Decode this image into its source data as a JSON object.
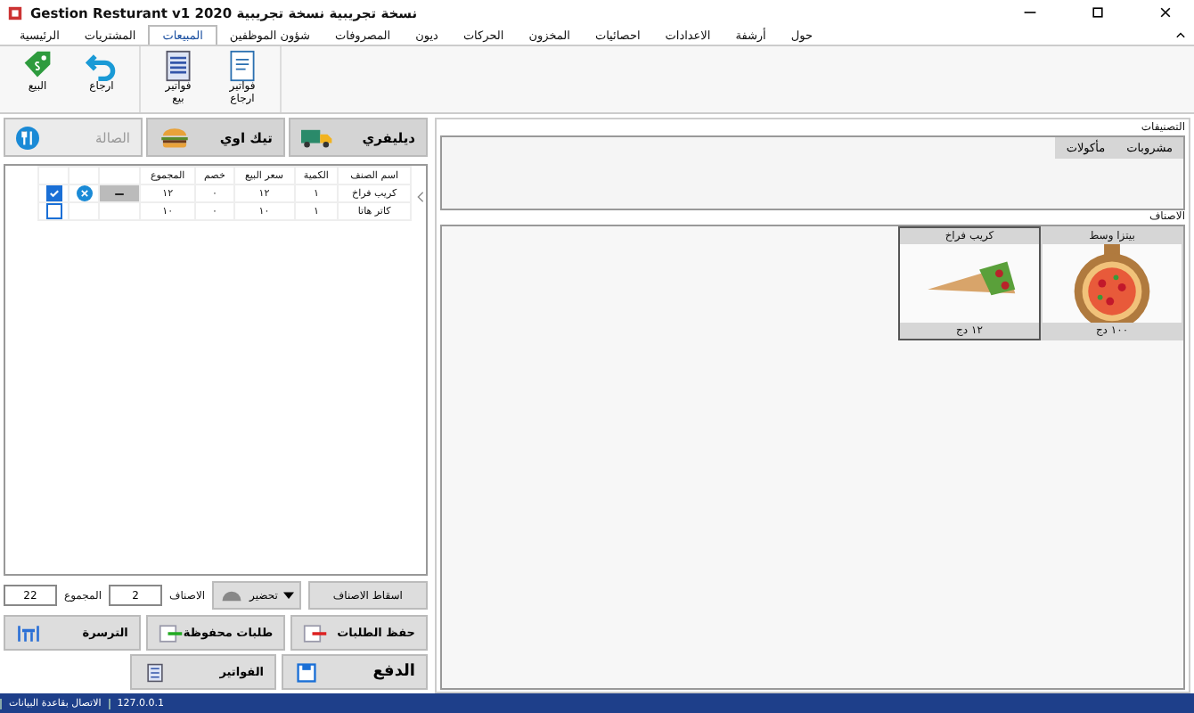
{
  "window": {
    "title": "Gestion Resturant v1 2020 نسخة تجريبية نسخة تجريبية"
  },
  "menu": [
    {
      "label": "حول",
      "selected": false
    },
    {
      "label": "أرشفة",
      "selected": false
    },
    {
      "label": "الاعدادات",
      "selected": false
    },
    {
      "label": "احصائيات",
      "selected": false
    },
    {
      "label": "المخزون",
      "selected": false
    },
    {
      "label": "الحركات",
      "selected": false
    },
    {
      "label": "ديون",
      "selected": false
    },
    {
      "label": "المصروفات",
      "selected": false
    },
    {
      "label": "شؤون الموظفين",
      "selected": false
    },
    {
      "label": "المبيعات",
      "selected": true
    },
    {
      "label": "المشتريات",
      "selected": false
    },
    {
      "label": "الرئيسية",
      "selected": false
    }
  ],
  "ribbon": [
    {
      "label": "فواتير\nارجاع",
      "kind": "doc"
    },
    {
      "label": "فواتير\nبيع",
      "kind": "list"
    },
    {
      "label": "ارجاع",
      "kind": "undo"
    },
    {
      "label": "البيع",
      "kind": "tag"
    }
  ],
  "categories": {
    "title": "التصنيفات",
    "tabs": [
      {
        "label": "مشروبات"
      },
      {
        "label": "مأكولات"
      }
    ]
  },
  "products": {
    "title": "الاصناف",
    "items": [
      {
        "name": "بيتزا وسط",
        "price": "١٠٠ دج",
        "kind": "pizza",
        "selected": false
      },
      {
        "name": "كريب فراخ",
        "price": "١٢ دج",
        "kind": "wrap",
        "selected": true
      }
    ]
  },
  "order_tabs": [
    {
      "label": "ديليفري",
      "kind": "truck",
      "selected": false
    },
    {
      "label": "تيك اوي",
      "kind": "burger",
      "selected": false
    },
    {
      "label": "الصالة",
      "kind": "dining",
      "selected": true
    }
  ],
  "table": {
    "columns": [
      "اسم الصنف",
      "الكمية",
      "سعر البيع",
      "خصم",
      "المجموع"
    ],
    "rows": [
      {
        "cells": [
          "كريب فراخ",
          "١",
          "١٢",
          "٠",
          "١٢"
        ],
        "selected": true,
        "checked": true
      },
      {
        "cells": [
          "كاتر هاتا",
          "١",
          "١٠",
          "٠",
          "١٠"
        ],
        "selected": false,
        "checked": false
      }
    ]
  },
  "controls": {
    "drop_button": "اسقاط الاصناف",
    "prepare": "تحضير",
    "items_label": "الاصناف",
    "items_count": "2",
    "total_label": "المجموع",
    "total": "22"
  },
  "actions": [
    {
      "label": "حفظ الطلبات",
      "kind": "save-order"
    },
    {
      "label": "طلبات محفوظة",
      "kind": "saved"
    },
    {
      "label": "الترسرة",
      "kind": "tables"
    },
    {
      "label": "الدفع",
      "kind": "pay"
    },
    {
      "label": "الفواتير",
      "kind": "invoices"
    }
  ],
  "status_bar": [
    "127.0.0.1",
    "الاتصال بقاعدة البيانات"
  ]
}
